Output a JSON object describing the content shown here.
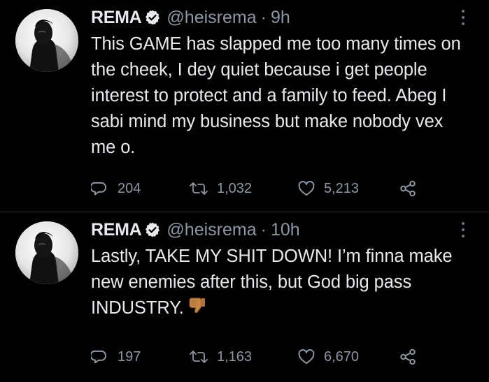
{
  "tweets": [
    {
      "name": "REMA",
      "handle": "@heisrema",
      "separator": "·",
      "time": "9h",
      "text": "This GAME has slapped me too many times on the cheek, I dey quiet because i get people interest to protect and a family to feed. Abeg I sabi mind my business but make nobody vex me o.",
      "replies": "204",
      "retweets": "1,032",
      "likes": "5,213"
    },
    {
      "name": "REMA",
      "handle": "@heisrema",
      "separator": "·",
      "time": "10h",
      "text": "Lastly, TAKE MY SHIT DOWN! I’m finna make new enemies after this, but God big pass INDUSTRY.",
      "emoji": "thumbs-down-emoji",
      "replies": "197",
      "retweets": "1,163",
      "likes": "6,670"
    }
  ],
  "icons": {
    "verified": "verified-badge-icon",
    "more": "more-options-icon",
    "reply": "reply-icon",
    "retweet": "retweet-icon",
    "like": "like-icon",
    "share": "share-icon"
  },
  "colors": {
    "background": "#000000",
    "text": "#e7e9ea",
    "muted": "#8b98a5",
    "divider": "#2f3336"
  }
}
